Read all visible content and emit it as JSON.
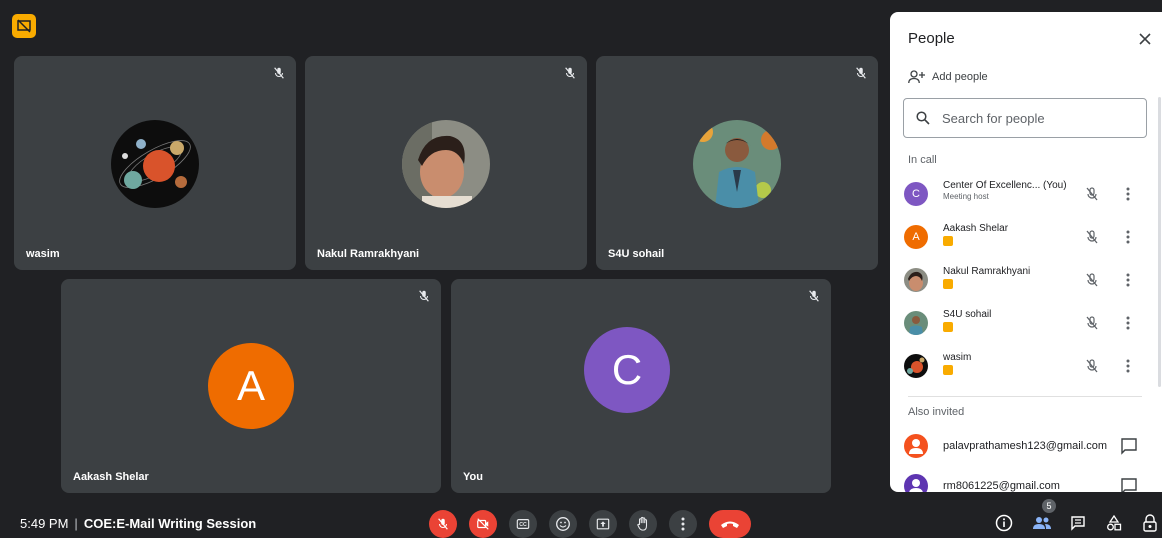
{
  "meeting": {
    "time": "5:49 PM",
    "separator": "|",
    "title": "COE:E-Mail Writing Session"
  },
  "colors": {
    "background": "#202124",
    "tile": "#3c4043",
    "accent_orange": "#ef6c00",
    "accent_purple": "#7e57c2",
    "end_call_red": "#ea4335",
    "badge_yellow": "#f9ab00"
  },
  "tiles": [
    {
      "name": "wasim",
      "avatar": "planets-photo",
      "muted": true
    },
    {
      "name": "Nakul Ramrakhyani",
      "avatar": "person-photo",
      "muted": true
    },
    {
      "name": "S4U sohail",
      "avatar": "person-photo",
      "muted": true
    },
    {
      "name": "Aakash Shelar",
      "avatar_letter": "A",
      "muted": true
    },
    {
      "name": "You",
      "avatar_letter": "C",
      "muted": true
    }
  ],
  "controls": {
    "buttons": [
      "mic-off",
      "camera-off",
      "captions",
      "emoji",
      "present",
      "raise-hand",
      "more-options",
      "end-call"
    ],
    "right_buttons": [
      "info",
      "people",
      "chat",
      "activities",
      "host-controls"
    ],
    "people_count": "5"
  },
  "panel": {
    "title": "People",
    "add_people": "Add people",
    "search_placeholder": "Search for people",
    "in_call_label": "In call",
    "also_invited_label": "Also invited",
    "in_call": [
      {
        "name": "Center Of Excellenc... (You)",
        "subtitle": "Meeting host",
        "letter": "C"
      },
      {
        "name": "Aakash Shelar",
        "letter": "A"
      },
      {
        "name": "Nakul Ramrakhyani"
      },
      {
        "name": "S4U sohail"
      },
      {
        "name": "wasim"
      }
    ],
    "invited": [
      {
        "email": "palavprathamesh123@gmail.com"
      },
      {
        "email": "rm8061225@gmail.com"
      }
    ]
  }
}
